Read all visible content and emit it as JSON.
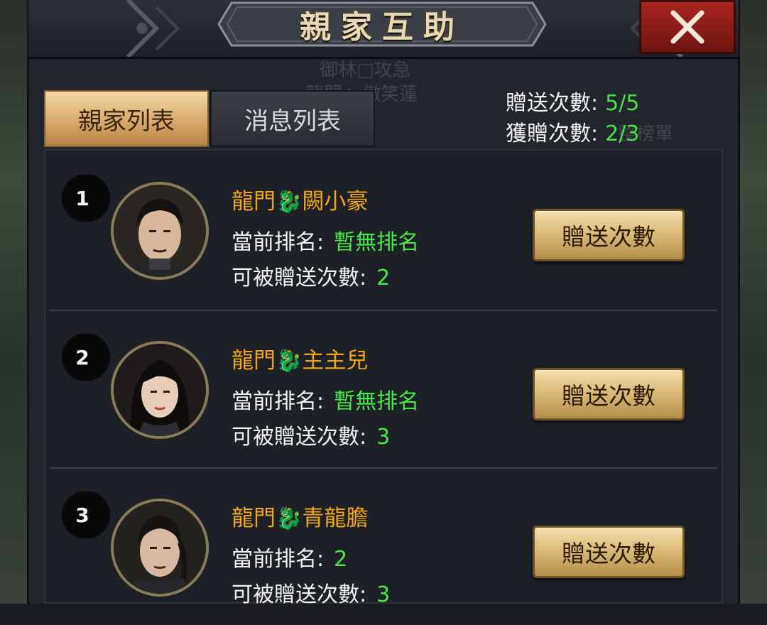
{
  "title": "親家互助",
  "tabs": [
    {
      "label": "親家列表",
      "active": true
    },
    {
      "label": "消息列表",
      "active": false
    }
  ],
  "stats": {
    "send_label": "贈送次數:",
    "send_value": "5/5",
    "received_label": "獲贈次數:",
    "received_value": "2/3"
  },
  "rank_label": "當前排名:",
  "giftable_label": "可被贈送次數:",
  "button_label": "贈送次數",
  "entries": [
    {
      "rank": "1",
      "prefix": "龍門",
      "name": "闕小豪",
      "ranking": "暫無排名",
      "giftable": "2",
      "portrait": "male-short-hair"
    },
    {
      "rank": "2",
      "prefix": "龍門",
      "name": "主主兒",
      "ranking": "暫無排名",
      "giftable": "3",
      "portrait": "female-long-hair"
    },
    {
      "rank": "3",
      "prefix": "龍門",
      "name": "青龍膽",
      "ranking": "2",
      "giftable": "3",
      "portrait": "male-braided-hair"
    }
  ],
  "colors": {
    "name": "#f0a51e",
    "highlight_green": "#4ae64a",
    "close_red": "#a8261e",
    "tab_gold": "#d9a86a"
  }
}
